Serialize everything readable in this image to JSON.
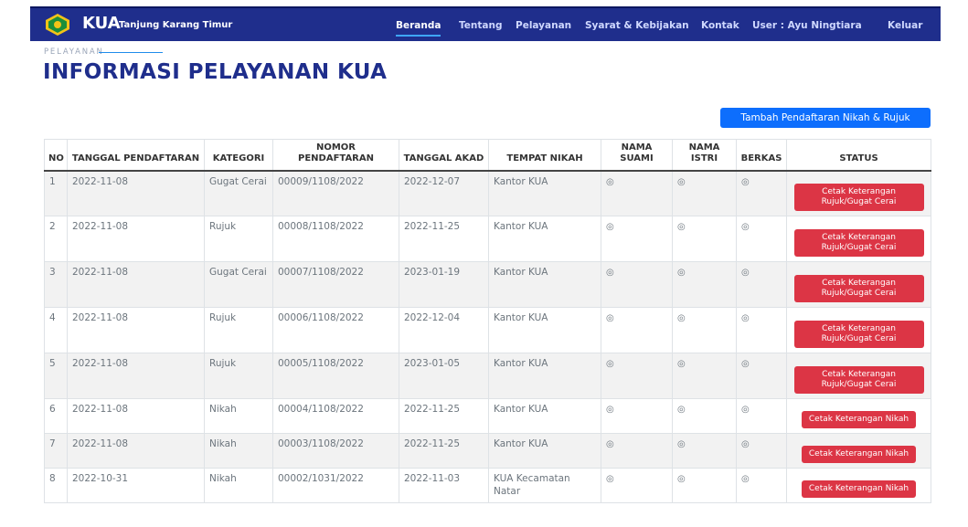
{
  "brand": {
    "name": "KUA",
    "subtitle": "Tanjung Karang Timur"
  },
  "nav": [
    {
      "label": "Beranda",
      "active": true
    },
    {
      "label": "Tentang"
    },
    {
      "label": "Pelayanan"
    },
    {
      "label": "Syarat & Kebijakan"
    },
    {
      "label": "Kontak"
    },
    {
      "label": "User : Ayu Ningtiara"
    },
    {
      "label": "Keluar"
    }
  ],
  "page": {
    "eyebrow": "PELAYANAN",
    "title": "INFORMASI PELAYANAN KUA",
    "add_button": "Tambah Pendaftaran Nikah & Rujuk"
  },
  "table": {
    "headers": [
      "NO",
      "TANGGAL PENDAFTARAN",
      "KATEGORI",
      "NOMOR PENDAFTARAN",
      "TANGGAL AKAD",
      "TEMPAT NIKAH",
      "NAMA SUAMI",
      "NAMA ISTRI",
      "BERKAS",
      "STATUS"
    ],
    "rows": [
      {
        "no": "1",
        "tanggal": "2022-11-08",
        "kategori": "Gugat Cerai",
        "nomor": "00009/1108/2022",
        "akad": "2022-12-07",
        "tempat": "Kantor KUA",
        "status": "Cetak Keterangan Rujuk/Gugat Cerai"
      },
      {
        "no": "2",
        "tanggal": "2022-11-08",
        "kategori": "Rujuk",
        "nomor": "00008/1108/2022",
        "akad": "2022-11-25",
        "tempat": "Kantor KUA",
        "status": "Cetak Keterangan Rujuk/Gugat Cerai"
      },
      {
        "no": "3",
        "tanggal": "2022-11-08",
        "kategori": "Gugat Cerai",
        "nomor": "00007/1108/2022",
        "akad": "2023-01-19",
        "tempat": "Kantor KUA",
        "status": "Cetak Keterangan Rujuk/Gugat Cerai"
      },
      {
        "no": "4",
        "tanggal": "2022-11-08",
        "kategori": "Rujuk",
        "nomor": "00006/1108/2022",
        "akad": "2022-12-04",
        "tempat": "Kantor KUA",
        "status": "Cetak Keterangan Rujuk/Gugat Cerai"
      },
      {
        "no": "5",
        "tanggal": "2022-11-08",
        "kategori": "Rujuk",
        "nomor": "00005/1108/2022",
        "akad": "2023-01-05",
        "tempat": "Kantor KUA",
        "status": "Cetak Keterangan Rujuk/Gugat Cerai"
      },
      {
        "no": "6",
        "tanggal": "2022-11-08",
        "kategori": "Nikah",
        "nomor": "00004/1108/2022",
        "akad": "2022-11-25",
        "tempat": "Kantor KUA",
        "status": "Cetak Keterangan Nikah"
      },
      {
        "no": "7",
        "tanggal": "2022-11-08",
        "kategori": "Nikah",
        "nomor": "00003/1108/2022",
        "akad": "2022-11-25",
        "tempat": "Kantor KUA",
        "status": "Cetak Keterangan Nikah"
      },
      {
        "no": "8",
        "tanggal": "2022-10-31",
        "kategori": "Nikah",
        "nomor": "00002/1031/2022",
        "akad": "2022-11-03",
        "tempat": "KUA Kecamatan Natar",
        "status": "Cetak Keterangan Nikah"
      }
    ]
  },
  "icons": {
    "view": "eye-icon",
    "logo": "kemenag-logo-icon"
  },
  "colors": {
    "navbar": "#1f2e8c",
    "title": "#1f2e8c",
    "primary_button": "#0d6efd",
    "danger_button": "#dc3545"
  }
}
